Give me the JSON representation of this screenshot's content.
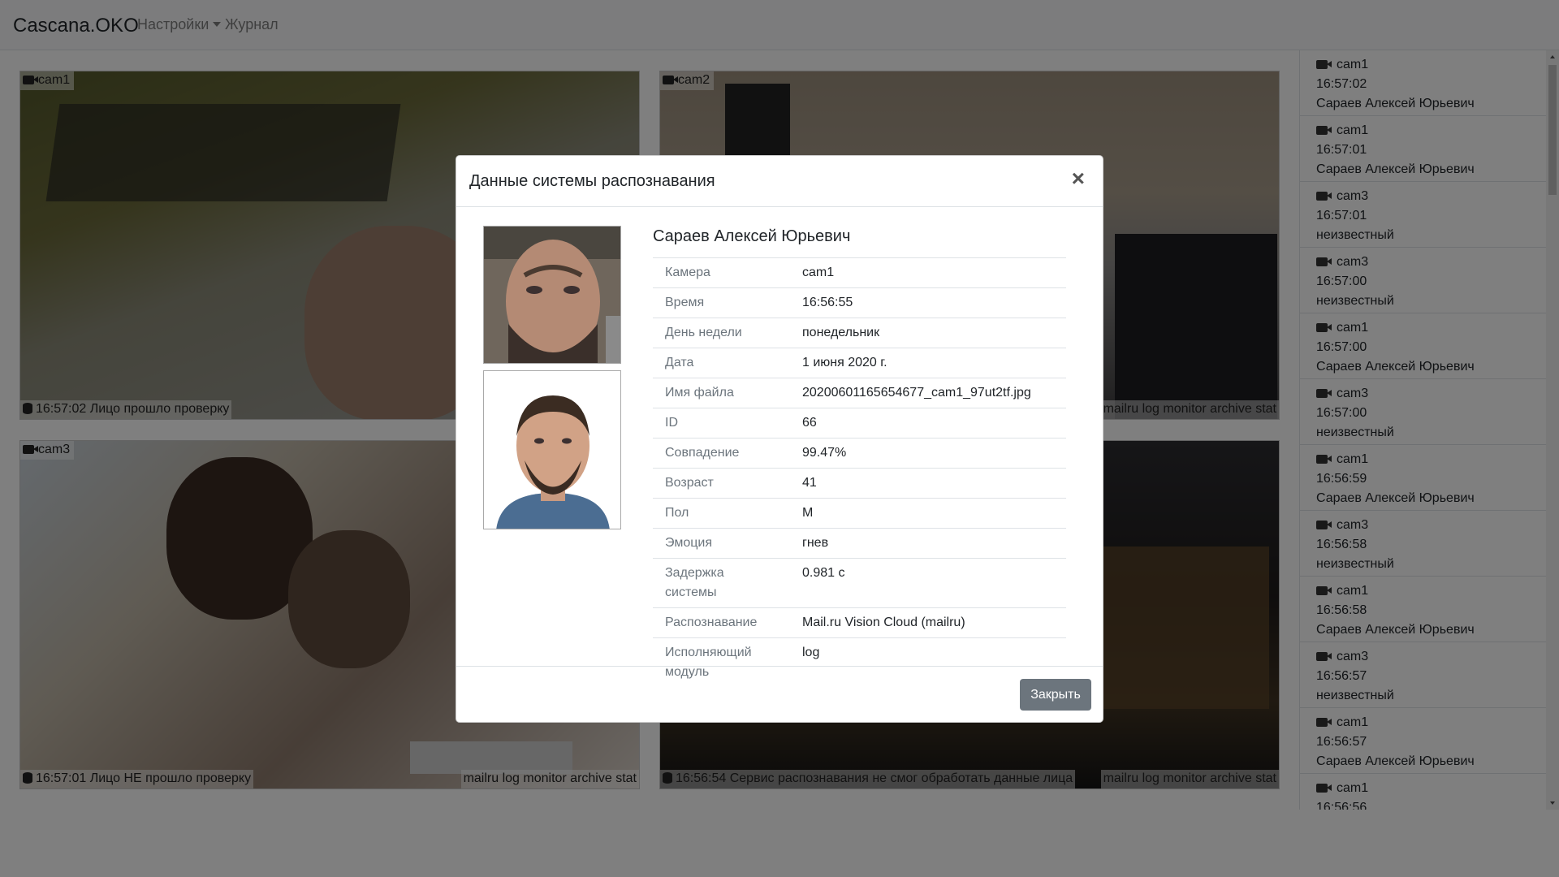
{
  "navbar": {
    "brand": "Cascana.OKO",
    "settings": "Настройки",
    "journal": "Журнал"
  },
  "cameras": [
    {
      "label": "cam1",
      "status": "16:57:02 Лицо прошло проверку",
      "links": ""
    },
    {
      "label": "cam2",
      "status": "",
      "links": "mailru log monitor archive stat"
    },
    {
      "label": "cam3",
      "status": "16:57:01 Лицо НЕ прошло проверку",
      "links": "mailru log monitor archive stat"
    },
    {
      "label": "",
      "status": "16:56:54 Сервис распознавания не смог обработать данные лица",
      "links": "mailru log monitor archive stat"
    }
  ],
  "events": [
    {
      "cam": "cam1",
      "time": "16:57:02",
      "name": "Сараев Алексей Юрьевич"
    },
    {
      "cam": "cam1",
      "time": "16:57:01",
      "name": "Сараев Алексей Юрьевич"
    },
    {
      "cam": "cam3",
      "time": "16:57:01",
      "name": "неизвестный"
    },
    {
      "cam": "cam3",
      "time": "16:57:00",
      "name": "неизвестный"
    },
    {
      "cam": "cam1",
      "time": "16:57:00",
      "name": "Сараев Алексей Юрьевич"
    },
    {
      "cam": "cam3",
      "time": "16:57:00",
      "name": "неизвестный"
    },
    {
      "cam": "cam1",
      "time": "16:56:59",
      "name": "Сараев Алексей Юрьевич"
    },
    {
      "cam": "cam3",
      "time": "16:56:58",
      "name": "неизвестный"
    },
    {
      "cam": "cam1",
      "time": "16:56:58",
      "name": "Сараев Алексей Юрьевич"
    },
    {
      "cam": "cam3",
      "time": "16:56:57",
      "name": "неизвестный"
    },
    {
      "cam": "cam1",
      "time": "16:56:57",
      "name": "Сараев Алексей Юрьевич"
    },
    {
      "cam": "cam1",
      "time": "16:56:56",
      "name": ""
    }
  ],
  "modal": {
    "title": "Данные системы распознавания",
    "close_symbol": "×",
    "person_name": "Сараев Алексей Юрьевич",
    "rows": [
      {
        "key": "Камера",
        "value": "cam1"
      },
      {
        "key": "Время",
        "value": "16:56:55"
      },
      {
        "key": "День недели",
        "value": "понедельник"
      },
      {
        "key": "Дата",
        "value": "1 июня 2020 г."
      },
      {
        "key": "Имя файла",
        "value": "20200601165654677_cam1_97ut2tf.jpg"
      },
      {
        "key": "ID",
        "value": "66"
      },
      {
        "key": "Совпадение",
        "value": "99.47%"
      },
      {
        "key": "Возраст",
        "value": "41"
      },
      {
        "key": "Пол",
        "value": "M"
      },
      {
        "key": "Эмоция",
        "value": "гнев"
      },
      {
        "key": "Задержка системы",
        "value": "0.981 с"
      },
      {
        "key": "Распознавание",
        "value": "Mail.ru Vision Cloud (mailru)"
      },
      {
        "key": "Исполняющий модуль",
        "value": "log"
      }
    ],
    "footer_button": "Закрыть"
  }
}
